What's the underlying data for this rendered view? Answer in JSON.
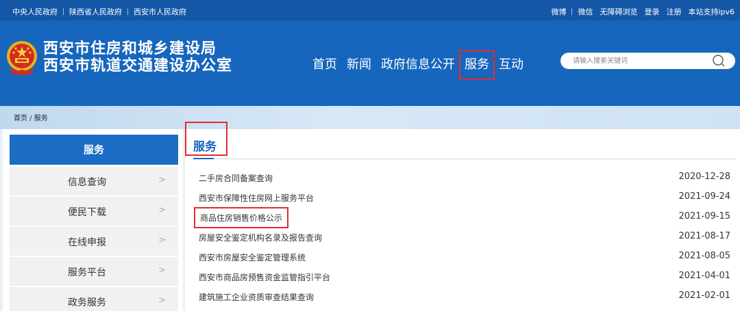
{
  "topbar": {
    "left_links": [
      "中央人民政府",
      "陕西省人民政府",
      "西安市人民政府"
    ],
    "right_links": [
      "微博",
      "微信",
      "无障碍浏览",
      "登录",
      "注册",
      "本站支持ipv6"
    ]
  },
  "header": {
    "title_line1": "西安市住房和城乡建设局",
    "title_line2": "西安市轨道交通建设办公室",
    "nav": [
      "首页",
      "新闻",
      "政府信息公开",
      "服务",
      "互动"
    ],
    "active_nav": "服务",
    "search_placeholder": "请输入搜索关键词"
  },
  "breadcrumb": "首页 / 服务",
  "sidebar": {
    "heading": "服务",
    "items": [
      "信息查询",
      "便民下载",
      "在线申报",
      "服务平台",
      "政务服务"
    ]
  },
  "main": {
    "title": "服务",
    "rows": [
      {
        "name": "二手房合同备案查询",
        "date": "2020-12-28"
      },
      {
        "name": "西安市保障性住房网上服务平台",
        "date": "2021-09-24"
      },
      {
        "name": "商品住房销售价格公示",
        "date": "2021-09-15"
      },
      {
        "name": "房屋安全鉴定机构名录及报告查询",
        "date": "2021-08-17"
      },
      {
        "name": "西安市房屋安全鉴定管理系统",
        "date": "2021-08-05"
      },
      {
        "name": "西安市商品房预售资金监管指引平台",
        "date": "2021-04-01"
      },
      {
        "name": "建筑施工企业资质审查结果查询",
        "date": "2021-02-01"
      }
    ]
  },
  "colors": {
    "brand_blue": "#1766bd",
    "highlight_red": "#e52a2a"
  },
  "icons": {
    "emblem": "national-emblem-icon",
    "search": "search-icon",
    "arrow": "chevron-right-icon"
  }
}
